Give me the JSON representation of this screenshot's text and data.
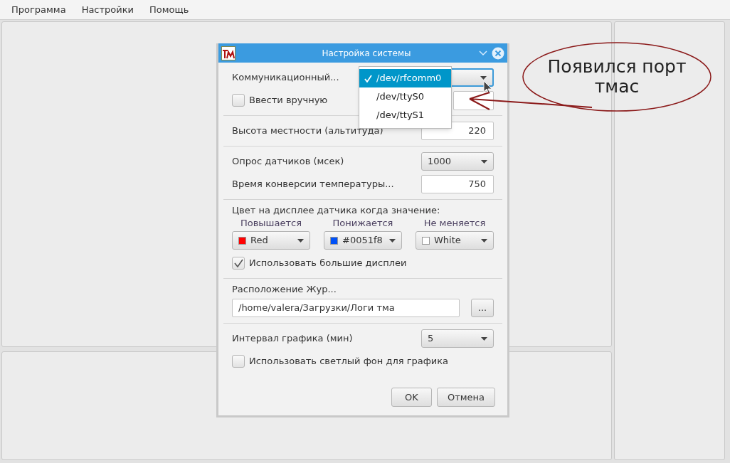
{
  "menu": [
    "Программа",
    "Настройки",
    "Помощь"
  ],
  "dialog": {
    "title": "Настройка системы",
    "sections": [
      [
        {
          "kind": "combo",
          "label": "Коммуникационный...",
          "focused": true
        },
        {
          "kind": "checkbox",
          "label": "Ввести вручную",
          "checked": false,
          "field": true
        }
      ],
      [
        {
          "kind": "input",
          "label": "Высота местности (альтитуда)",
          "value": "220"
        }
      ],
      [
        {
          "kind": "combo",
          "label": "Опрос датчиков (мсек)",
          "value": "1000",
          "focused": false
        },
        {
          "kind": "input",
          "label": "Время конверсии температуры...",
          "value": "750"
        }
      ],
      [
        {
          "kind": "heading",
          "label": "Цвет на дисплее датчика когда значение:"
        },
        {
          "kind": "colors",
          "pickers": [
            {
              "label": "Повышается",
              "value": "Red",
              "color": "#ff0000"
            },
            {
              "label": "Понижается",
              "value": "#0051f8",
              "color": "#0051f8"
            },
            {
              "label": "Не меняется",
              "value": "White",
              "color": "#ffffff"
            }
          ]
        },
        {
          "kind": "checkbox",
          "label": "Использовать большие дисплеи",
          "checked": true
        }
      ],
      [
        {
          "kind": "heading",
          "label": "Расположение Жур..."
        },
        {
          "kind": "path",
          "value": "/home/valera/Загрузки/Логи тма",
          "button": "..."
        }
      ],
      [
        {
          "kind": "combo",
          "label": "Интервал графика (мин)",
          "value": "5",
          "focused": false
        },
        {
          "kind": "checkbox",
          "label": "Использовать светлый фон для графика",
          "checked": false
        }
      ]
    ],
    "buttons": [
      "OK",
      "Отмена"
    ]
  },
  "dropdown": {
    "options": [
      {
        "label": "/dev/rfcomm0",
        "selected": true
      },
      {
        "label": "/dev/ttyS0",
        "selected": false
      },
      {
        "label": "/dev/ttyS1",
        "selected": false
      }
    ]
  },
  "annotation": {
    "text": "Появился порт тмас"
  }
}
